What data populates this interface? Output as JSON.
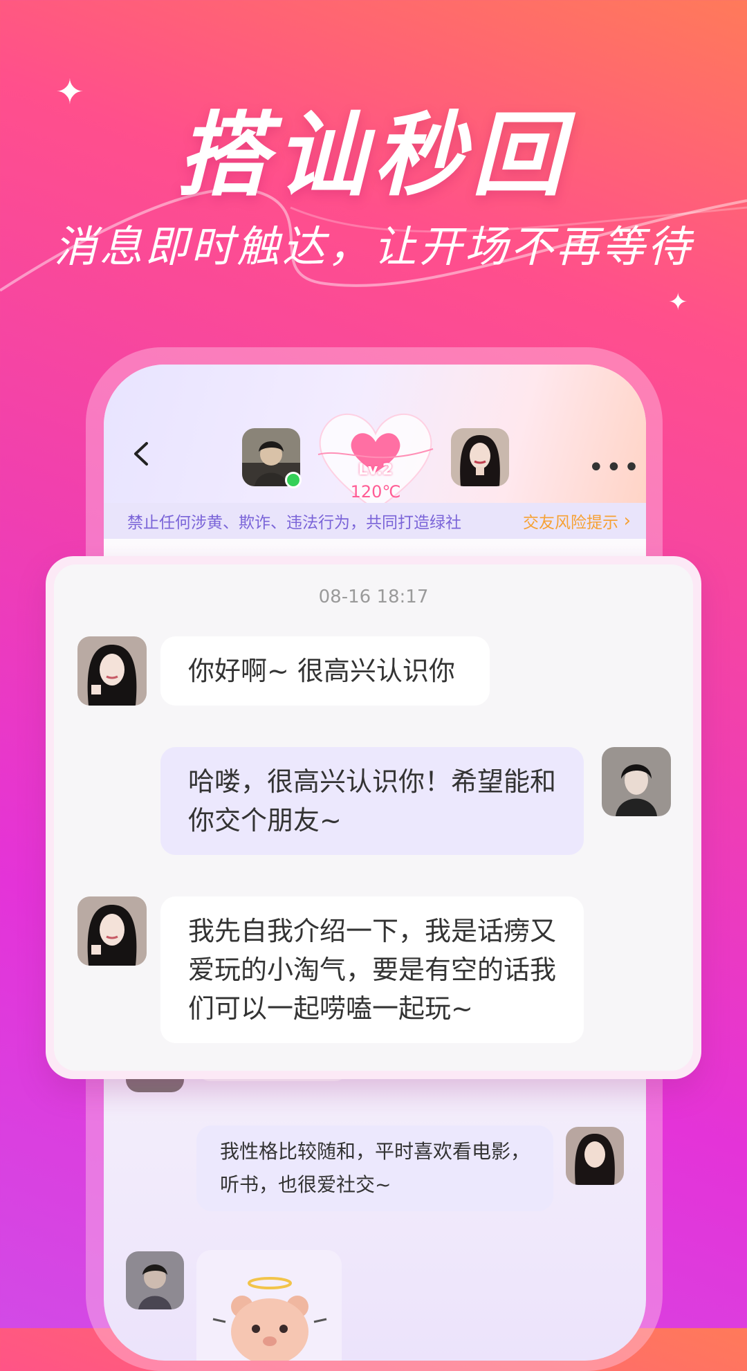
{
  "hero": {
    "headline": "搭讪秒回",
    "subheadline": "消息即时触达，让开场不再等待"
  },
  "chat_header": {
    "level": "Lv.2",
    "temperature": "120℃"
  },
  "notice": {
    "text": "禁止任何涉黄、欺诈、违法行为，共同打造绿社",
    "link": "交友风险提示"
  },
  "card": {
    "timestamp": "08-16 18:17",
    "messages": [
      {
        "from": "her",
        "text": "你好啊~ 很高兴认识你"
      },
      {
        "from": "me",
        "text": "哈喽，很高兴认识你！希望能和你交个朋友~"
      },
      {
        "from": "her",
        "text": "我先自我介绍一下，我是话痨又爱玩的小淘气，要是有空的话我们可以一起唠嗑一起玩~"
      }
    ]
  },
  "background_chat": {
    "messages": [
      {
        "from": "other",
        "text": "我性格比较随和，平时喜欢看电影，听书，也很爱社交~"
      }
    ]
  },
  "colors": {
    "accent_pink": "#ff4f8c",
    "accent_purple": "#7a64d8",
    "risk_orange": "#f6a133",
    "online_green": "#34d058"
  },
  "icons": [
    "back-arrow-icon",
    "more-icon",
    "heart-icon",
    "sparkle-icon",
    "bear-sticker-icon"
  ]
}
